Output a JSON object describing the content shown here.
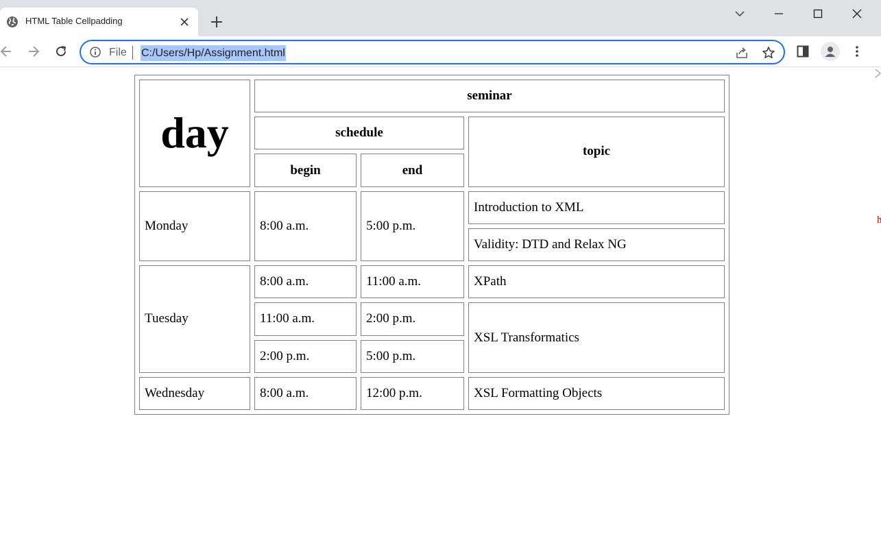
{
  "browser": {
    "tab_title": "HTML Table Cellpadding",
    "scheme_label": "File",
    "url": "C:/Users/Hp/Assignment.html",
    "accent_color": "#1a73e8",
    "icons": [
      "globe-icon",
      "close-icon",
      "plus-icon",
      "chevron-down-icon",
      "minimize-icon",
      "maximize-icon",
      "close-window-icon",
      "back-icon",
      "forward-icon",
      "reload-icon",
      "info-icon",
      "share-icon",
      "star-icon",
      "side-panel-icon",
      "profile-icon",
      "menu-icon"
    ]
  },
  "stray_text": "h",
  "table": {
    "day_header": "day",
    "seminar_header": "seminar",
    "schedule_header": "schedule",
    "topic_header": "topic",
    "begin_header": "begin",
    "end_header": "end",
    "rows": {
      "monday": {
        "day": "Monday",
        "begin": "8:00 a.m.",
        "end": "5:00 p.m.",
        "topic1": "Introduction to XML",
        "topic2": "Validity: DTD and Relax NG"
      },
      "tuesday": {
        "day": "Tuesday",
        "slots": [
          {
            "begin": "8:00 a.m.",
            "end": "11:00 a.m."
          },
          {
            "begin": "11:00 a.m.",
            "end": "2:00 p.m."
          },
          {
            "begin": "2:00 p.m.",
            "end": "5:00 p.m."
          }
        ],
        "topic1": "XPath",
        "topic2": "XSL Transformatics"
      },
      "wednesday": {
        "day": "Wednesday",
        "begin": "8:00 a.m.",
        "end": "12:00 p.m.",
        "topic": "XSL Formatting Objects"
      }
    }
  }
}
